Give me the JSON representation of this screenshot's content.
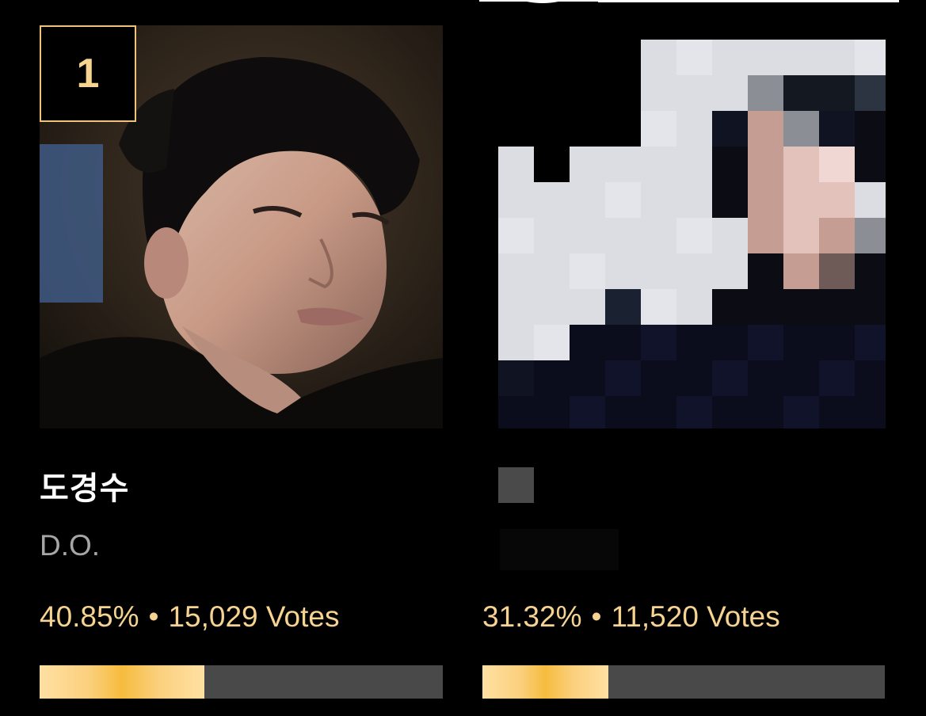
{
  "candidates": [
    {
      "rank": "1",
      "name": "도경수",
      "subname": "D.O.",
      "percent": "40.85%",
      "separator": "•",
      "votes": "15,029 Votes",
      "progress": 0.4085,
      "photo_icon": "portrait-photo"
    },
    {
      "percent": "31.32%",
      "separator": "•",
      "votes": "11,520 Votes",
      "progress": 0.3132,
      "photo_icon": "pixelated-portrait"
    }
  ],
  "colors": {
    "accent": "#f6d391",
    "bar_track": "#494949",
    "bar_fill_mid": "#f6bc3e",
    "subtext": "#a6a6a6"
  }
}
